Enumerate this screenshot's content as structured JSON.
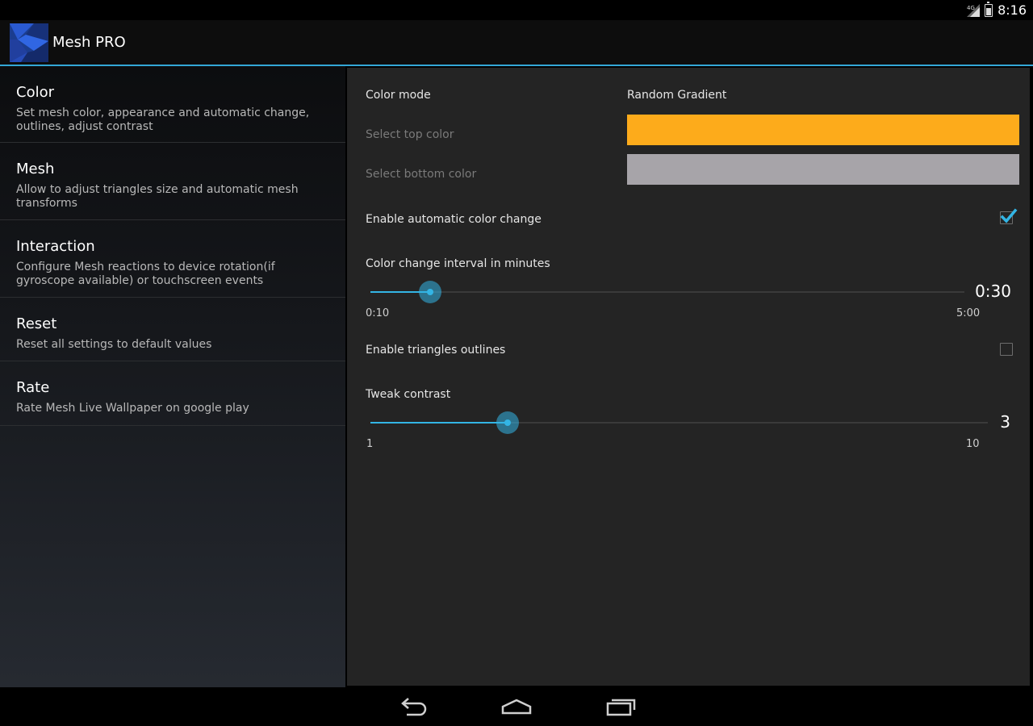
{
  "status": {
    "time": "8:16",
    "network": "4G"
  },
  "app": {
    "title": "Mesh PRO"
  },
  "headers": [
    {
      "title": "Color",
      "summary": "Set mesh color, appearance and automatic change, outlines, adjust contrast"
    },
    {
      "title": "Mesh",
      "summary": "Allow to adjust triangles size and automatic mesh transforms"
    },
    {
      "title": "Interaction",
      "summary": "Configure Mesh reactions to device rotation(if gyroscope available) or touchscreen events"
    },
    {
      "title": "Reset",
      "summary": "Reset all settings to default values"
    },
    {
      "title": "Rate",
      "summary": "Rate Mesh Live Wallpaper on google play"
    }
  ],
  "color_prefs": {
    "color_mode": {
      "label": "Color mode",
      "value": "Random Gradient"
    },
    "top_color": {
      "label": "Select top color",
      "color": "#fdab1b"
    },
    "bottom_color": {
      "label": "Select bottom color",
      "color": "#a7a4a9"
    },
    "auto_change": {
      "label": "Enable automatic color change",
      "checked": true
    },
    "interval": {
      "label": "Color change interval in minutes",
      "value": "0:30",
      "min": "0:10",
      "max": "5:00",
      "fraction": 0.1
    },
    "outlines": {
      "label": "Enable triangles outlines",
      "checked": false
    },
    "contrast": {
      "label": "Tweak contrast",
      "value": "3",
      "min": "1",
      "max": "10",
      "fraction": 0.222
    }
  },
  "accent_color": "#33b5e5",
  "nav": {
    "back": "back-icon",
    "home": "home-icon",
    "recents": "recents-icon"
  }
}
